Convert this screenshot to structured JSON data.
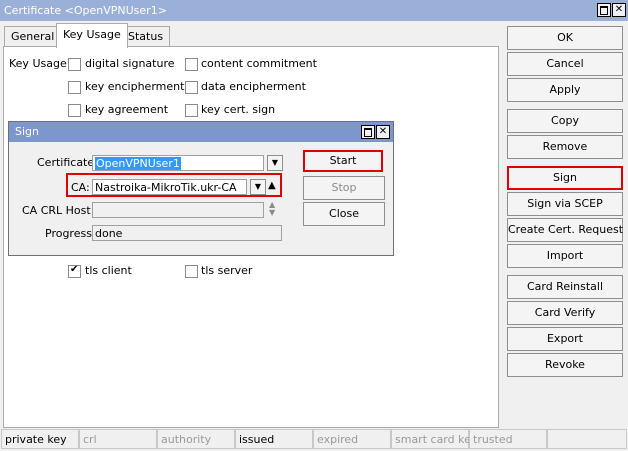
{
  "window": {
    "title": "Certificate <OpenVPNUser1>"
  },
  "tabs": [
    {
      "label": "General"
    },
    {
      "label": "Key Usage"
    },
    {
      "label": "Status"
    }
  ],
  "key_usage": {
    "label": "Key Usage:",
    "options": [
      {
        "label": "digital signature",
        "checked": false
      },
      {
        "label": "content commitment",
        "checked": false
      },
      {
        "label": "key encipherment",
        "checked": false
      },
      {
        "label": "data encipherment",
        "checked": false
      },
      {
        "label": "key agreement",
        "checked": false
      },
      {
        "label": "key cert. sign",
        "checked": false
      },
      {
        "label": "tls client",
        "checked": true
      },
      {
        "label": "tls server",
        "checked": false
      }
    ]
  },
  "buttons": {
    "ok": "OK",
    "cancel": "Cancel",
    "apply": "Apply",
    "copy": "Copy",
    "remove": "Remove",
    "sign": "Sign",
    "sign_via_scep": "Sign via SCEP",
    "create_cert_request": "Create Cert. Request",
    "import": "Import",
    "card_reinstall": "Card Reinstall",
    "card_verify": "Card Verify",
    "export": "Export",
    "revoke": "Revoke"
  },
  "sign_dialog": {
    "title": "Sign",
    "certificate_label": "Certificate:",
    "certificate_value": "OpenVPNUser1",
    "ca_label": "CA:",
    "ca_value": "Nastroika-MikroTik.ukr-CA",
    "ca_crl_host_label": "CA CRL Host:",
    "ca_crl_host_value": "",
    "progress_label": "Progress:",
    "progress_value": "done",
    "start": "Start",
    "stop": "Stop",
    "close": "Close"
  },
  "status_bar": [
    {
      "text": "private key",
      "active": true
    },
    {
      "text": "crl",
      "active": false
    },
    {
      "text": "authority",
      "active": false
    },
    {
      "text": "issued",
      "active": true
    },
    {
      "text": "expired",
      "active": false
    },
    {
      "text": "smart card key",
      "active": false
    },
    {
      "text": "trusted",
      "active": false
    },
    {
      "text": "",
      "active": false
    }
  ],
  "colors": {
    "highlight": "#e00000",
    "title_bar": "#9bb0d8",
    "dialog_title": "#7d97cc",
    "selection": "#3399ff"
  }
}
